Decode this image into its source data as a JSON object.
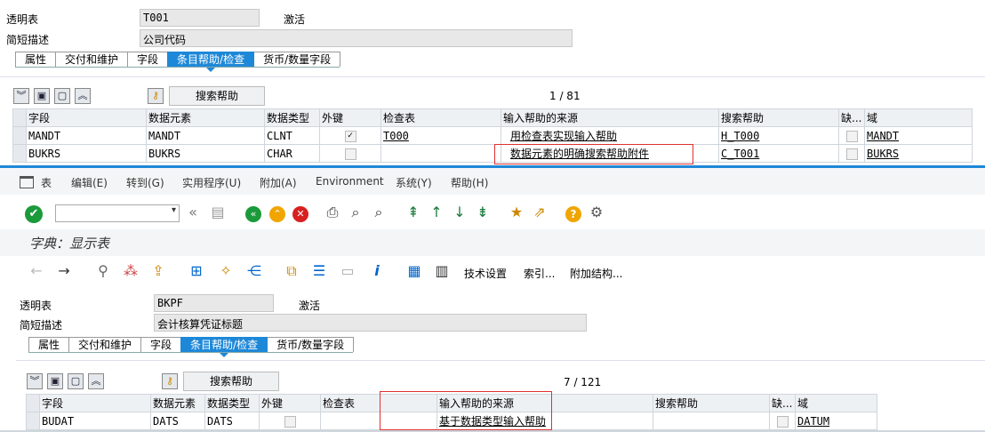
{
  "top": {
    "table_label": "透明表",
    "table_value": "T001",
    "status": "激活",
    "desc_label": "简短描述",
    "desc_value": "公司代码",
    "tabs": [
      "属性",
      "交付和维护",
      "字段",
      "条目帮助/检查",
      "货币/数量字段"
    ],
    "search_help_btn": "搜索帮助",
    "pager": "1  /  81",
    "columns": [
      "字段",
      "数据元素",
      "数据类型",
      "外键",
      "检查表",
      "输入帮助的来源",
      "搜索帮助",
      "缺...",
      "域"
    ],
    "rows": [
      {
        "field": "MANDT",
        "element": "MANDT",
        "type": "CLNT",
        "fk": "✓",
        "check": "T000",
        "source": "用检查表实现输入帮助",
        "help": "H_T000",
        "domain": "MANDT"
      },
      {
        "field": "BUKRS",
        "element": "BUKRS",
        "type": "CHAR",
        "fk": "",
        "check": "",
        "source": "数据元素的明确搜索帮助附件",
        "help": "C_T001",
        "domain": "BUKRS"
      }
    ]
  },
  "menubar": [
    "表",
    "编辑(E)",
    "转到(G)",
    "实用程序(U)",
    "附加(A)",
    "Environment",
    "系统(Y)",
    "帮助(H)"
  ],
  "title": "字典：显示表",
  "app_toolbar": {
    "tech_settings": "技术设置",
    "index": "索引...",
    "append": "附加结构..."
  },
  "bottom": {
    "table_label": "透明表",
    "table_value": "BKPF",
    "status": "激活",
    "desc_label": "简短描述",
    "desc_value": "会计核算凭证标题",
    "tabs": [
      "属性",
      "交付和维护",
      "字段",
      "条目帮助/检查",
      "货币/数量字段"
    ],
    "search_help_btn": "搜索帮助",
    "pager": "7  /  121",
    "columns": [
      "字段",
      "数据元素",
      "数据类型",
      "外键",
      "检查表",
      "输入帮助的来源",
      "搜索帮助",
      "缺...",
      "域"
    ],
    "rows": [
      {
        "field": "BUDAT",
        "element": "DATS",
        "type": "DATS",
        "fk": "",
        "check": "",
        "source": "基于数据类型输入帮助",
        "help": "",
        "domain": "DATUM"
      }
    ]
  },
  "colors": {
    "accent": "#1e88d8",
    "highlight": "#e03030"
  }
}
